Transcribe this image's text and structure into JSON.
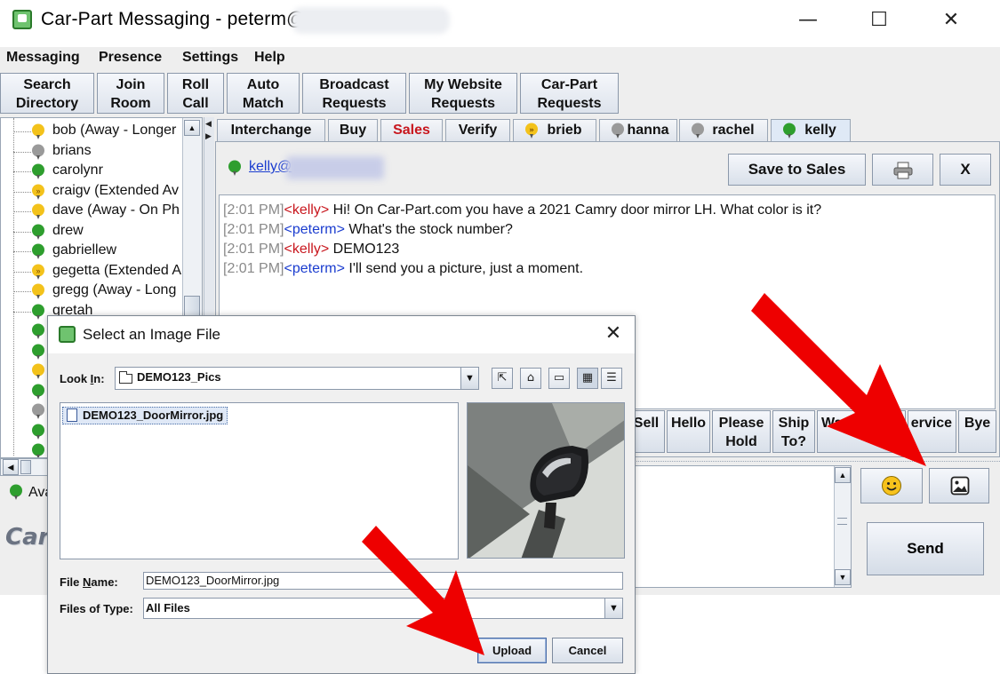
{
  "window": {
    "title": "Car-Part Messaging - peterm@",
    "controls": {
      "minimize": "—",
      "maximize": "☐",
      "close": "✕"
    }
  },
  "menu": [
    "Messaging",
    "Presence",
    "Settings",
    "Help"
  ],
  "toolbar": [
    {
      "line1": "Search",
      "line2": "Directory"
    },
    {
      "line1": "Join",
      "line2": "Room"
    },
    {
      "line1": "Roll",
      "line2": "Call"
    },
    {
      "line1": "Auto",
      "line2": "Match"
    },
    {
      "line1": "Broadcast",
      "line2": "Requests"
    },
    {
      "line1": "My Website",
      "line2": "Requests"
    },
    {
      "line1": "Car-Part",
      "line2": "Requests"
    }
  ],
  "contacts": [
    {
      "name": "bob (Away - Longer",
      "status": "yellow"
    },
    {
      "name": "brians",
      "status": "gray"
    },
    {
      "name": "carolynr",
      "status": "green"
    },
    {
      "name": "craigv (Extended Av",
      "status": "extended"
    },
    {
      "name": "dave (Away - On Ph",
      "status": "yellow"
    },
    {
      "name": "drew",
      "status": "green"
    },
    {
      "name": "gabriellew",
      "status": "green"
    },
    {
      "name": "gegetta (Extended A",
      "status": "extended"
    },
    {
      "name": "gregg (Away - Long",
      "status": "yellow"
    },
    {
      "name": "gretah",
      "status": "green"
    }
  ],
  "hidden_contact_statuses": [
    "green",
    "green",
    "yellow",
    "green",
    "gray",
    "green",
    "green",
    "green"
  ],
  "tabs": [
    {
      "label": "Interchange",
      "type": "plain"
    },
    {
      "label": "Buy",
      "type": "plain"
    },
    {
      "label": "Sales",
      "type": "sales"
    },
    {
      "label": "Verify",
      "type": "plain"
    },
    {
      "label": "brieb",
      "type": "extended"
    },
    {
      "label": "hanna",
      "type": "gray"
    },
    {
      "label": "rachel",
      "type": "gray"
    },
    {
      "label": "kelly",
      "type": "green",
      "active": true
    }
  ],
  "chat": {
    "email": "kelly@",
    "buttons": {
      "save": "Save to Sales",
      "print_icon": "printer-icon",
      "close": "X"
    },
    "messages": [
      {
        "time": "[2:01 PM]",
        "from": "<kelly>",
        "sender": "kelly",
        "text": " Hi! On Car-Part.com you have a 2021 Camry door mirror LH. What color is it?"
      },
      {
        "time": "[2:01 PM]",
        "from": "<peterm>",
        "sender": "peterm",
        "text": " What's the stock number?"
      },
      {
        "time": "[2:01 PM]",
        "from": "<kelly>",
        "sender": "kelly",
        "text": " DEMO123"
      },
      {
        "time": "[2:01 PM]",
        "from": "<peterm>",
        "sender": "peterm",
        "text": " I'll send you a picture, just a moment."
      }
    ]
  },
  "quick_buttons": [
    {
      "line1": "Sell",
      "line2": ""
    },
    {
      "line1": "Hello",
      "line2": ""
    },
    {
      "line1": "Please",
      "line2": "Hold"
    },
    {
      "line1": "Ship",
      "line2": "To?"
    },
    {
      "line1": "Wa",
      "line2": ""
    },
    {
      "line1": "ervice",
      "line2": ""
    },
    {
      "line1": "Bye",
      "line2": ""
    }
  ],
  "input": {
    "emoji_icon": "smiley-icon",
    "image_icon": "image-icon",
    "send": "Send"
  },
  "status": {
    "label": "Ava"
  },
  "logo": {
    "text": "Car"
  },
  "dialog": {
    "title": "Select an Image File",
    "look_in_label": "Look In:",
    "look_in_value": "DEMO123_Pics",
    "file": "DEMO123_DoorMirror.jpg",
    "file_name_label": "File Name:",
    "file_name_value": "DEMO123_DoorMirror.jpg",
    "file_type_label": "Files of Type:",
    "file_type_value": "All Files",
    "upload": "Upload",
    "cancel": "Cancel",
    "close": "✕"
  },
  "colors": {
    "window_bg": "#eeeeee",
    "kelly_color": "#c8161d",
    "peterm_color": "#1a3ccf",
    "timestamp_color": "#8a8a8a",
    "arrow_red": "#ee0000",
    "status_green": "#2e9e2e",
    "status_yellow": "#f3c21b",
    "status_gray": "#9a9a9a"
  }
}
